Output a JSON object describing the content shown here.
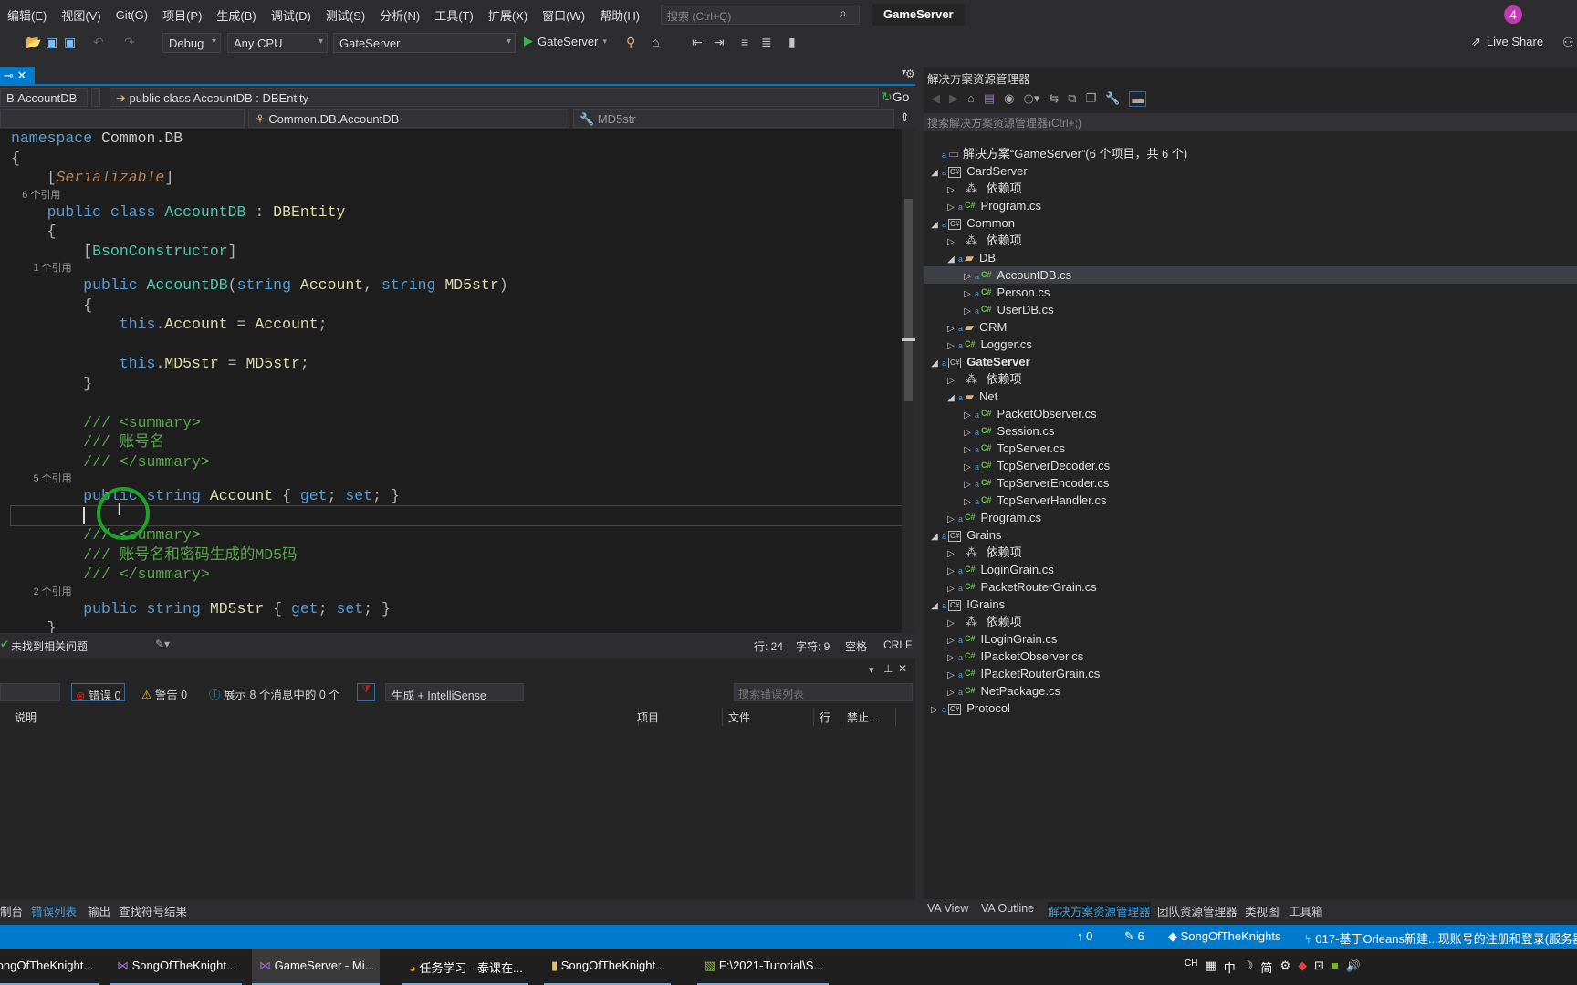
{
  "menu": [
    "编辑(E)",
    "视图(V)",
    "Git(G)",
    "项目(P)",
    "生成(B)",
    "调试(D)",
    "测试(S)",
    "分析(N)",
    "工具(T)",
    "扩展(X)",
    "窗口(W)",
    "帮助(H)"
  ],
  "search_placeholder": "搜索 (Ctrl+Q)",
  "window_title": "GameServer",
  "notification_count": "4",
  "toolbar": {
    "config": "Debug",
    "platform": "Any CPU",
    "startup": "GateServer",
    "run": "GateServer",
    "live_share": "Live Share"
  },
  "nav": {
    "scope": "B.AccountDB",
    "member": "public class AccountDB : DBEntity",
    "go": "Go",
    "type": "Common.DB.AccountDB",
    "field": "MD5str"
  },
  "code": [
    {
      "t": "c",
      "s": [
        [
          "kw",
          "namespace "
        ],
        [
          "ns",
          "Common.DB"
        ]
      ]
    },
    {
      "t": "c",
      "s": [
        [
          "pu",
          "{"
        ]
      ]
    },
    {
      "t": "c",
      "s": [
        [
          "pu",
          "    ["
        ],
        [
          "at",
          "Serializable"
        ],
        [
          "pu",
          "]"
        ]
      ]
    },
    {
      "t": "l",
      "s": [
        [
          "",
          "    6 个引用"
        ]
      ]
    },
    {
      "t": "c",
      "s": [
        [
          "kw",
          "    public class "
        ],
        [
          "ty",
          "AccountDB"
        ],
        [
          "pu",
          " : "
        ],
        [
          "id",
          "DBEntity"
        ]
      ]
    },
    {
      "t": "c",
      "s": [
        [
          "pu",
          "    {"
        ]
      ]
    },
    {
      "t": "c",
      "s": [
        [
          "pu",
          "        ["
        ],
        [
          "ty",
          "BsonConstructor"
        ],
        [
          "pu",
          "]"
        ]
      ]
    },
    {
      "t": "l",
      "s": [
        [
          "",
          "        1 个引用"
        ]
      ]
    },
    {
      "t": "c",
      "s": [
        [
          "kw",
          "        public "
        ],
        [
          "ty",
          "AccountDB"
        ],
        [
          "pu",
          "("
        ],
        [
          "kw",
          "string "
        ],
        [
          "id",
          "Account"
        ],
        [
          "pu",
          ", "
        ],
        [
          "kw",
          "string "
        ],
        [
          "id",
          "MD5str"
        ],
        [
          "pu",
          ")"
        ]
      ]
    },
    {
      "t": "c",
      "s": [
        [
          "pu",
          "        {"
        ]
      ]
    },
    {
      "t": "c",
      "s": [
        [
          "kw",
          "            this"
        ],
        [
          "pu",
          "."
        ],
        [
          "id",
          "Account"
        ],
        [
          "pu",
          " = "
        ],
        [
          "id",
          "Account"
        ],
        [
          "pu",
          ";"
        ]
      ]
    },
    {
      "t": "c",
      "s": [
        [
          "",
          ""
        ]
      ]
    },
    {
      "t": "c",
      "s": [
        [
          "kw",
          "            this"
        ],
        [
          "pu",
          "."
        ],
        [
          "id",
          "MD5str"
        ],
        [
          "pu",
          " = "
        ],
        [
          "id",
          "MD5str"
        ],
        [
          "pu",
          ";"
        ]
      ]
    },
    {
      "t": "c",
      "s": [
        [
          "pu",
          "        }"
        ]
      ]
    },
    {
      "t": "c",
      "s": [
        [
          "",
          ""
        ]
      ]
    },
    {
      "t": "c",
      "s": [
        [
          "cm",
          "        /// <summary>"
        ]
      ]
    },
    {
      "t": "c",
      "s": [
        [
          "cm",
          "        /// 账号名"
        ]
      ]
    },
    {
      "t": "c",
      "s": [
        [
          "cm",
          "        /// </summary>"
        ]
      ]
    },
    {
      "t": "l",
      "s": [
        [
          "",
          "        5 个引用"
        ]
      ]
    },
    {
      "t": "c",
      "s": [
        [
          "kw",
          "        public string "
        ],
        [
          "id",
          "Account"
        ],
        [
          "pu",
          " { "
        ],
        [
          "kw",
          "get"
        ],
        [
          "pu",
          "; "
        ],
        [
          "kw",
          "set"
        ],
        [
          "pu",
          "; }"
        ]
      ]
    },
    {
      "t": "cur",
      "s": [
        [
          "",
          "        "
        ]
      ]
    },
    {
      "t": "c",
      "s": [
        [
          "cm",
          "        /// <summary>"
        ]
      ]
    },
    {
      "t": "c",
      "s": [
        [
          "cm",
          "        /// 账号名和密码生成的MD5码"
        ]
      ]
    },
    {
      "t": "c",
      "s": [
        [
          "cm",
          "        /// </summary>"
        ]
      ]
    },
    {
      "t": "l",
      "s": [
        [
          "",
          "        2 个引用"
        ]
      ]
    },
    {
      "t": "c",
      "s": [
        [
          "kw",
          "        public string "
        ],
        [
          "id",
          "MD5str"
        ],
        [
          "pu",
          " { "
        ],
        [
          "kw",
          "get"
        ],
        [
          "pu",
          "; "
        ],
        [
          "kw",
          "set"
        ],
        [
          "pu",
          "; }"
        ]
      ]
    },
    {
      "t": "c",
      "s": [
        [
          "pu",
          "    }"
        ]
      ]
    },
    {
      "t": "c",
      "s": [
        [
          "pu",
          "}"
        ]
      ]
    }
  ],
  "editor_status": {
    "issues": "未找到相关问题",
    "line": "行: 24",
    "col": "字符: 9",
    "indent": "空格",
    "eol": "CRLF"
  },
  "errors": {
    "errors": "错误 0",
    "warnings": "警告 0",
    "messages": "展示 8 个消息中的 0 个",
    "filter": "生成 + IntelliSense",
    "search_placeholder": "搜索错误列表",
    "columns": [
      "说明",
      "项目",
      "文件",
      "行",
      "禁止..."
    ]
  },
  "bottom_tabs_left": [
    "制台",
    "错误列表",
    "输出",
    "查找符号结果"
  ],
  "bottom_tabs_right": [
    "VA View",
    "VA Outline",
    "解决方案资源管理器",
    "团队资源管理器",
    "类视图",
    "工具箱"
  ],
  "solution": {
    "title": "解决方案资源管理器",
    "search_placeholder": "搜索解决方案资源管理器(Ctrl+;)",
    "tree": [
      {
        "d": 0,
        "k": "sln",
        "label": "解决方案“GameServer”(6 个项目，共 6 个)"
      },
      {
        "d": 0,
        "k": "proj",
        "e": "open",
        "label": "CardServer"
      },
      {
        "d": 1,
        "k": "dep",
        "e": "closed",
        "label": "依赖项"
      },
      {
        "d": 1,
        "k": "cs",
        "e": "closed",
        "label": "Program.cs"
      },
      {
        "d": 0,
        "k": "proj",
        "e": "open",
        "label": "Common"
      },
      {
        "d": 1,
        "k": "dep",
        "e": "closed",
        "label": "依赖项"
      },
      {
        "d": 1,
        "k": "folder",
        "e": "open",
        "label": "DB"
      },
      {
        "d": 2,
        "k": "cs",
        "e": "closed",
        "label": "AccountDB.cs",
        "sel": true
      },
      {
        "d": 2,
        "k": "cs",
        "e": "closed",
        "label": "Person.cs"
      },
      {
        "d": 2,
        "k": "cs",
        "e": "closed",
        "label": "UserDB.cs"
      },
      {
        "d": 1,
        "k": "folder",
        "e": "closed",
        "label": "ORM"
      },
      {
        "d": 1,
        "k": "cs",
        "e": "closed",
        "label": "Logger.cs"
      },
      {
        "d": 0,
        "k": "proj",
        "e": "open",
        "label": "GateServer",
        "bold": true
      },
      {
        "d": 1,
        "k": "dep",
        "e": "closed",
        "label": "依赖项"
      },
      {
        "d": 1,
        "k": "folder",
        "e": "open",
        "label": "Net"
      },
      {
        "d": 2,
        "k": "cs",
        "e": "closed",
        "label": "PacketObserver.cs"
      },
      {
        "d": 2,
        "k": "cs",
        "e": "closed",
        "label": "Session.cs"
      },
      {
        "d": 2,
        "k": "cs",
        "e": "closed",
        "label": "TcpServer.cs"
      },
      {
        "d": 2,
        "k": "cs",
        "e": "closed",
        "label": "TcpServerDecoder.cs"
      },
      {
        "d": 2,
        "k": "cs",
        "e": "closed",
        "label": "TcpServerEncoder.cs"
      },
      {
        "d": 2,
        "k": "cs",
        "e": "closed",
        "label": "TcpServerHandler.cs"
      },
      {
        "d": 1,
        "k": "cs",
        "e": "closed",
        "label": "Program.cs"
      },
      {
        "d": 0,
        "k": "proj",
        "e": "open",
        "label": "Grains"
      },
      {
        "d": 1,
        "k": "dep",
        "e": "closed",
        "label": "依赖项"
      },
      {
        "d": 1,
        "k": "cs",
        "e": "closed",
        "label": "LoginGrain.cs"
      },
      {
        "d": 1,
        "k": "cs",
        "e": "closed",
        "label": "PacketRouterGrain.cs"
      },
      {
        "d": 0,
        "k": "proj",
        "e": "open",
        "label": "IGrains"
      },
      {
        "d": 1,
        "k": "dep",
        "e": "closed",
        "label": "依赖项"
      },
      {
        "d": 1,
        "k": "cs",
        "e": "closed",
        "label": "ILoginGrain.cs"
      },
      {
        "d": 1,
        "k": "cs",
        "e": "closed",
        "label": "IPacketObserver.cs"
      },
      {
        "d": 1,
        "k": "cs",
        "e": "closed",
        "label": "IPacketRouterGrain.cs"
      },
      {
        "d": 1,
        "k": "cs",
        "e": "closed",
        "label": "NetPackage.cs"
      },
      {
        "d": 0,
        "k": "proj",
        "e": "closed",
        "label": "Protocol"
      }
    ]
  },
  "statusbar": {
    "up": "0",
    "edits": "6",
    "repo": "SongOfTheKnights",
    "branch": "017-基于Orleans新建...现账号的注册和登录(服务器"
  },
  "taskbar": [
    "SongOfTheKnight...",
    "SongOfTheKnight...",
    "GameServer - Mi...",
    "任务学习 - 泰课在...",
    "SongOfTheKnight...",
    "F:\\2021-Tutorial\\S..."
  ],
  "tray": {
    "lang": "CH",
    "ime": "中",
    "mode": "简"
  },
  "colors": {
    "accent": "#007acc",
    "editor_bg": "#1e1e1e",
    "keyword": "#569cd6",
    "type": "#4ec9b0",
    "comment": "#57a64a"
  }
}
